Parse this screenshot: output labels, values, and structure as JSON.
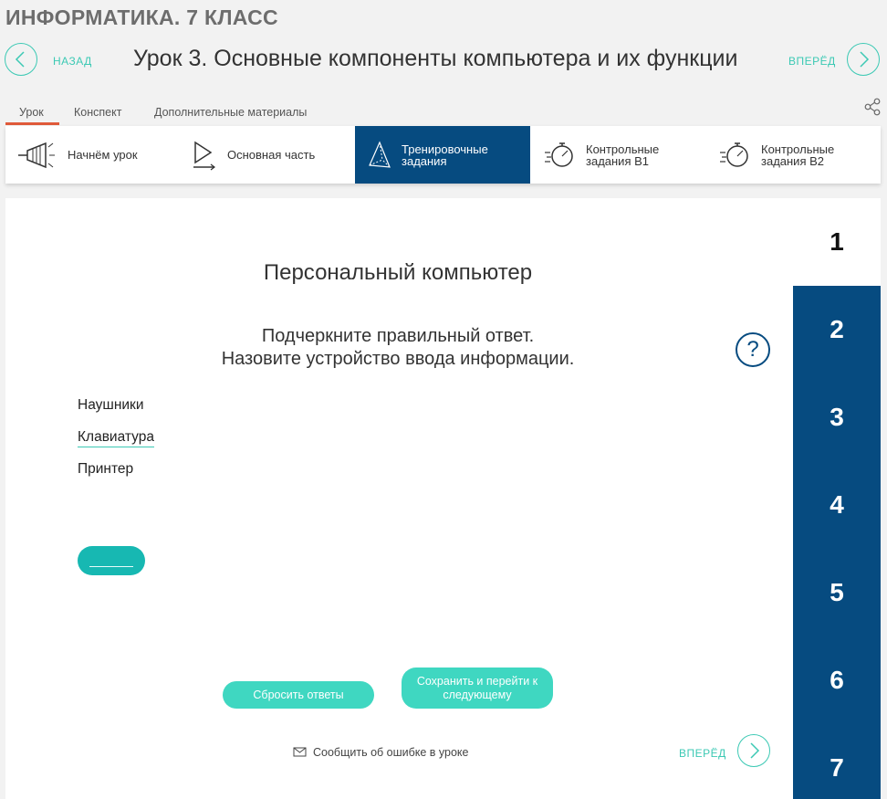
{
  "header": {
    "course_title": "ИНФОРМАТИКА. 7 КЛАСС",
    "back_label": "НАЗАД",
    "forward_label": "ВПЕРЁД",
    "lesson_title": "Урок 3. Основные компоненты компьютера и их функции"
  },
  "tabs": [
    {
      "label": "Урок",
      "active": true
    },
    {
      "label": "Конспект",
      "active": false
    },
    {
      "label": "Дополнительные материалы",
      "active": false
    }
  ],
  "steps": [
    {
      "label_line1": "Начнём урок",
      "label_line2": "",
      "icon": "megaphone-icon"
    },
    {
      "label_line1": "Основная часть",
      "label_line2": "",
      "icon": "play-icon"
    },
    {
      "label_line1": "Тренировочные",
      "label_line2": "задания",
      "icon": "pyramid-icon",
      "active": true
    },
    {
      "label_line1": "Контрольные",
      "label_line2": "задания В1",
      "icon": "stopwatch-icon"
    },
    {
      "label_line1": "Контрольные",
      "label_line2": "задания В2",
      "icon": "stopwatch-icon"
    }
  ],
  "task": {
    "heading": "Персональный компьютер",
    "instruction_line1": "Подчеркните правильный ответ.",
    "instruction_line2": "Назовите устройство ввода информации.",
    "help_symbol": "?",
    "answers": [
      {
        "text": "Наушники",
        "underlined": false
      },
      {
        "text": "Клавиатура",
        "underlined": true
      },
      {
        "text": "Принтер",
        "underlined": false
      }
    ]
  },
  "actions": {
    "reset_label": "Сбросить ответы",
    "save_next_line1": "Сохранить и перейти к",
    "save_next_line2": "следующему",
    "report_label": "Сообщить об ошибке в уроке",
    "forward_label": "ВПЕРЁД"
  },
  "task_numbers": [
    "1",
    "2",
    "3",
    "4",
    "5",
    "6",
    "7"
  ],
  "active_task": "1",
  "colors": {
    "accent": "#3cc9b4",
    "primary_dark": "#064b80",
    "tab_underline": "#e05a3a"
  }
}
